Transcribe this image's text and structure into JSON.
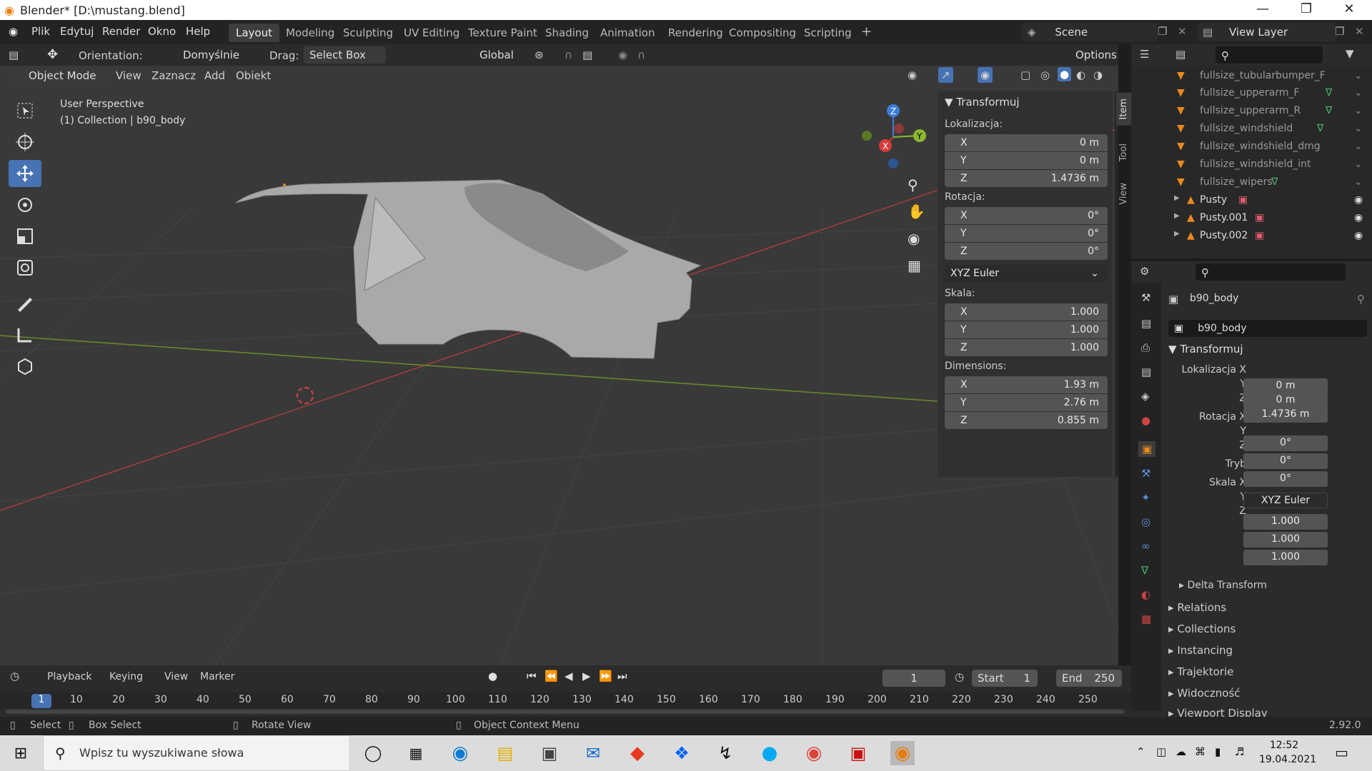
{
  "window": {
    "title": "Blender* [D:\\mustang.blend]"
  },
  "menu": [
    "Plik",
    "Edytuj",
    "Render",
    "Okno",
    "Help"
  ],
  "workspaces": [
    "Layout",
    "Modeling",
    "Sculpting",
    "UV Editing",
    "Texture Paint",
    "Shading",
    "Animation",
    "Rendering",
    "Compositing",
    "Scripting"
  ],
  "scene": {
    "name": "Scene",
    "view_layer": "View Layer"
  },
  "tool_header": {
    "orientation_label": "Orientation:",
    "orientation_value": "Domyślnie",
    "drag_label": "Drag:",
    "drag_value": "Select Box",
    "transform_orientation": "Global",
    "options": "Options"
  },
  "view_header": {
    "mode": "Object Mode",
    "items": [
      "View",
      "Zaznacz",
      "Add",
      "Obiekt"
    ]
  },
  "viewport": {
    "perspective": "User Perspective",
    "collection": "(1) Collection | b90_body"
  },
  "npanel": {
    "title": "Transformuj",
    "tabs": [
      "Item",
      "Tool",
      "View"
    ],
    "location_label": "Lokalizacja:",
    "location": [
      {
        "axis": "X",
        "value": "0 m"
      },
      {
        "axis": "Y",
        "value": "0 m"
      },
      {
        "axis": "Z",
        "value": "1.4736 m"
      }
    ],
    "rotation_label": "Rotacja:",
    "rotation": [
      {
        "axis": "X",
        "value": "0°"
      },
      {
        "axis": "Y",
        "value": "0°"
      },
      {
        "axis": "Z",
        "value": "0°"
      }
    ],
    "rotation_mode": "XYZ Euler",
    "scale_label": "Skala:",
    "scale": [
      {
        "axis": "X",
        "value": "1.000"
      },
      {
        "axis": "Y",
        "value": "1.000"
      },
      {
        "axis": "Z",
        "value": "1.000"
      }
    ],
    "dimensions_label": "Dimensions:",
    "dimensions": [
      {
        "axis": "X",
        "value": "1.93 m"
      },
      {
        "axis": "Y",
        "value": "2.76 m"
      },
      {
        "axis": "Z",
        "value": "0.855 m"
      }
    ]
  },
  "outliner": {
    "items": [
      {
        "name": "fullsize_tubularbumper_F"
      },
      {
        "name": "fullsize_upperarm_F"
      },
      {
        "name": "fullsize_upperarm_R"
      },
      {
        "name": "fullsize_windshield"
      },
      {
        "name": "fullsize_windshield_dmg"
      },
      {
        "name": "fullsize_windshield_int"
      },
      {
        "name": "fullsize_wipers"
      },
      {
        "name": "Pusty"
      },
      {
        "name": "Pusty.001"
      },
      {
        "name": "Pusty.002"
      }
    ]
  },
  "properties": {
    "object_name": "b90_body",
    "data_name": "b90_body",
    "section": "Transformuj",
    "loc_label": "Lokalizacja X",
    "loc": [
      "0 m",
      "0 m",
      "1.4736 m"
    ],
    "rot_label": "Rotacja X",
    "rot": [
      "0°",
      "0°",
      "0°"
    ],
    "mode_label": "Tryb",
    "mode_value": "XYZ Euler",
    "scale_label": "Skala X",
    "scale": [
      "1.000",
      "1.000",
      "1.000"
    ],
    "axis_y": "Y",
    "axis_z": "Z",
    "subsections": [
      "Delta Transform",
      "Relations",
      "Collections",
      "Instancing",
      "Trajektorie",
      "Widoczność",
      "Viewport Display"
    ]
  },
  "timeline": {
    "menus": [
      "Playback",
      "Keying",
      "View",
      "Marker"
    ],
    "current_frame": "1",
    "start_label": "Start",
    "start": "1",
    "end_label": "End",
    "end": "250",
    "ruler": [
      "10",
      "20",
      "30",
      "40",
      "50",
      "60",
      "70",
      "80",
      "90",
      "100",
      "110",
      "120",
      "130",
      "140",
      "150",
      "160",
      "170",
      "180",
      "190",
      "200",
      "210",
      "220",
      "230",
      "240",
      "250"
    ],
    "frame_marker": "1"
  },
  "statusbar": {
    "select": "Select",
    "box_select": "Box Select",
    "rotate": "Rotate View",
    "context": "Object Context Menu",
    "version": "2.92.0"
  },
  "taskbar": {
    "search_placeholder": "Wpisz tu wyszukiwane słowa",
    "time": "12:52",
    "date": "19.04.2021"
  }
}
